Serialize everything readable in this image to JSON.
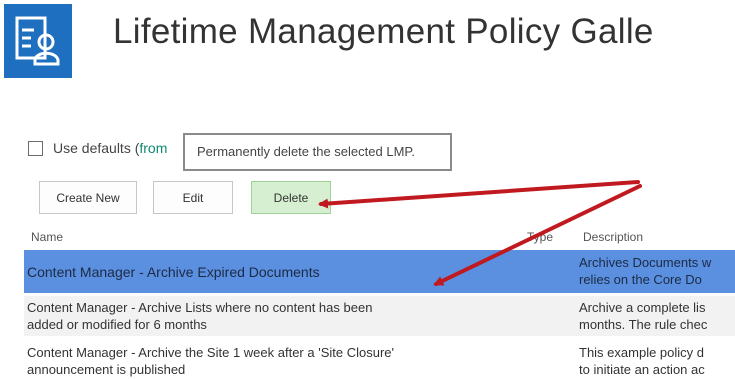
{
  "header": {
    "title": "Lifetime Management Policy Galle"
  },
  "controls": {
    "use_defaults_label": "Use defaults (",
    "use_defaults_link": "from",
    "tooltip": "Permanently delete the selected LMP."
  },
  "toolbar": {
    "create_label": "Create New",
    "edit_label": "Edit",
    "delete_label": "Delete"
  },
  "table": {
    "columns": [
      "Name",
      "Type",
      "Description"
    ],
    "rows": [
      {
        "name": "Content Manager - Archive Expired Documents",
        "description": "Archives Documents w\nrelies on the Core Do",
        "selected": true
      },
      {
        "name": "Content Manager - Archive Lists where no content has been\nadded or modified for 6 months",
        "description": "Archive a complete lis\nmonths. The rule chec",
        "selected": false
      },
      {
        "name": "Content Manager - Archive the Site 1 week after a 'Site Closure'\nannouncement is published",
        "description": "This example policy d\nto initiate an action ac",
        "selected": false
      }
    ]
  },
  "colors": {
    "brand": "#1e6fbf",
    "selected_row": "#5b8fe0",
    "delete_button": "#d6efd1",
    "annotation_arrow": "#c0191f",
    "link": "#0f8a73"
  },
  "icons": [
    "lmp-gallery-icon",
    "checkbox-icon",
    "annotation-arrow-icon"
  ]
}
